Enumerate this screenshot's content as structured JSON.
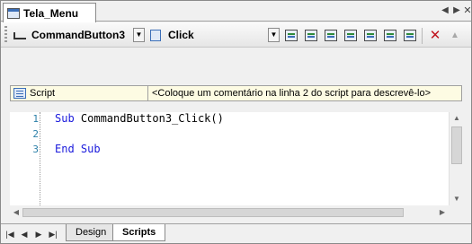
{
  "document_tab": {
    "title": "Tela_Menu"
  },
  "doc_nav": {
    "prev": "◀",
    "next": "▶",
    "close": "✕"
  },
  "toolbar": {
    "object_combo": "CommandButton3",
    "event_combo": "Click",
    "dropdown_glyph": "▼",
    "icons": [
      "script-add-icon",
      "script-window-icon",
      "script-list-icon",
      "script-properties-icon",
      "script-compile-icon",
      "script-debug-icon",
      "script-print-icon",
      "delete-icon",
      "up-arrow-icon"
    ],
    "delete_glyph": "✕",
    "up_glyph": "▲"
  },
  "comment_bar": {
    "label": "Script",
    "comment": "<Coloque um comentário na linha 2 do script para descrevê-lo>"
  },
  "editor": {
    "line_numbers": [
      "1",
      "2",
      "3"
    ],
    "lines": [
      {
        "kw": "Sub",
        "rest": " CommandButton3_Click()"
      },
      {
        "kw": "",
        "rest": ""
      },
      {
        "kw": "End Sub",
        "rest": ""
      }
    ]
  },
  "scroll": {
    "up": "▲",
    "down": "▼",
    "left": "◀",
    "right": "▶"
  },
  "bottom_nav": {
    "first": "|◀",
    "prev": "◀",
    "next": "▶",
    "last": "▶|"
  },
  "bottom_tabs": [
    {
      "label": "Design",
      "active": false
    },
    {
      "label": "Scripts",
      "active": true
    }
  ],
  "colors": {
    "keyword": "#1a1adc",
    "line_number": "#2b7fa8",
    "comment_bg": "#fdfbe3",
    "delete": "#c0141e"
  }
}
